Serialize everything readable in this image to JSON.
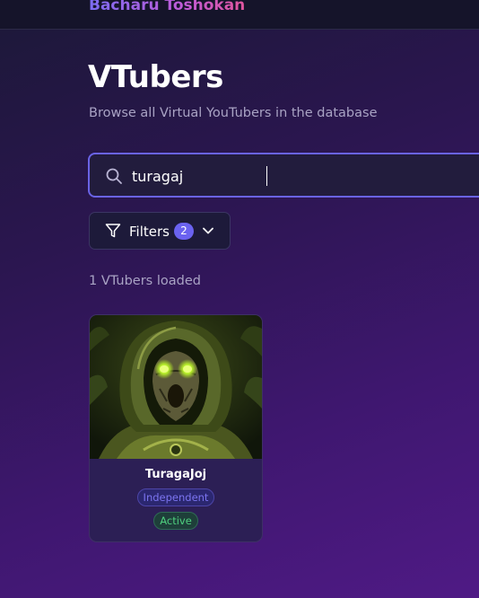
{
  "header": {
    "brand": "Bācharu Toshokan"
  },
  "page": {
    "title": "VTubers",
    "subtitle": "Browse all Virtual YouTubers in the database"
  },
  "search": {
    "value": "turagaj",
    "icon": "search-icon"
  },
  "filters": {
    "label": "Filters",
    "count": "2",
    "icon": "filter-icon",
    "toggle_icon": "chevron-down-icon"
  },
  "results": {
    "count_text": "1 VTubers loaded",
    "cards": [
      {
        "name": "TuragaJoj",
        "type": "Independent",
        "status": "Active"
      }
    ]
  },
  "colors": {
    "accent": "#6b62f0",
    "brand_gradient_start": "#7c6cf2",
    "brand_gradient_end": "#e0559e",
    "active_status": "#4fd07f"
  }
}
